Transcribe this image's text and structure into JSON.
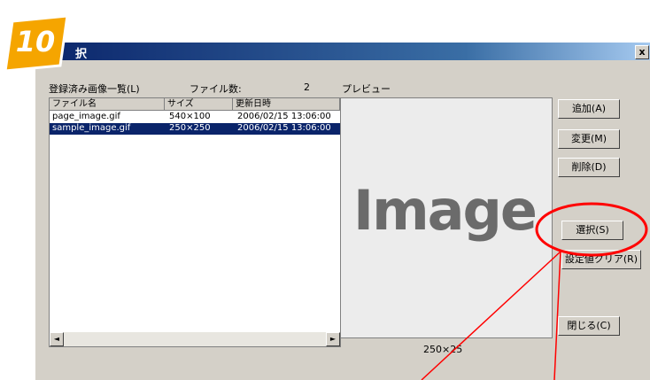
{
  "step_badge": "10",
  "dialog": {
    "title": "択",
    "close_label": "x"
  },
  "list_label": "登録済み画像一覧(L)",
  "file_count_label": "ファイル数:",
  "file_count_value": "2",
  "preview_label": "プレビュー",
  "columns": [
    "ファイル名",
    "サイズ",
    "更新日時"
  ],
  "rows": [
    {
      "name": "page_image.gif",
      "size": "540×100",
      "date": "2006/02/15 13:06:00",
      "selected": false
    },
    {
      "name": "sample_image.gif",
      "size": "250×250",
      "date": "2006/02/15 13:06:00",
      "selected": true
    }
  ],
  "scroll_left": "◄",
  "scroll_right": "►",
  "preview_image_text": "Image",
  "preview_size": "250×25",
  "buttons": {
    "add": "追加(A)",
    "change": "変更(M)",
    "delete": "削除(D)",
    "select": "選択(S)",
    "clear": "設定値クリア(R)",
    "close": "閉じる(C)"
  },
  "colors": {
    "badge": "#f5a500",
    "highlight": "#ff0000",
    "selection": "#0a246a"
  }
}
